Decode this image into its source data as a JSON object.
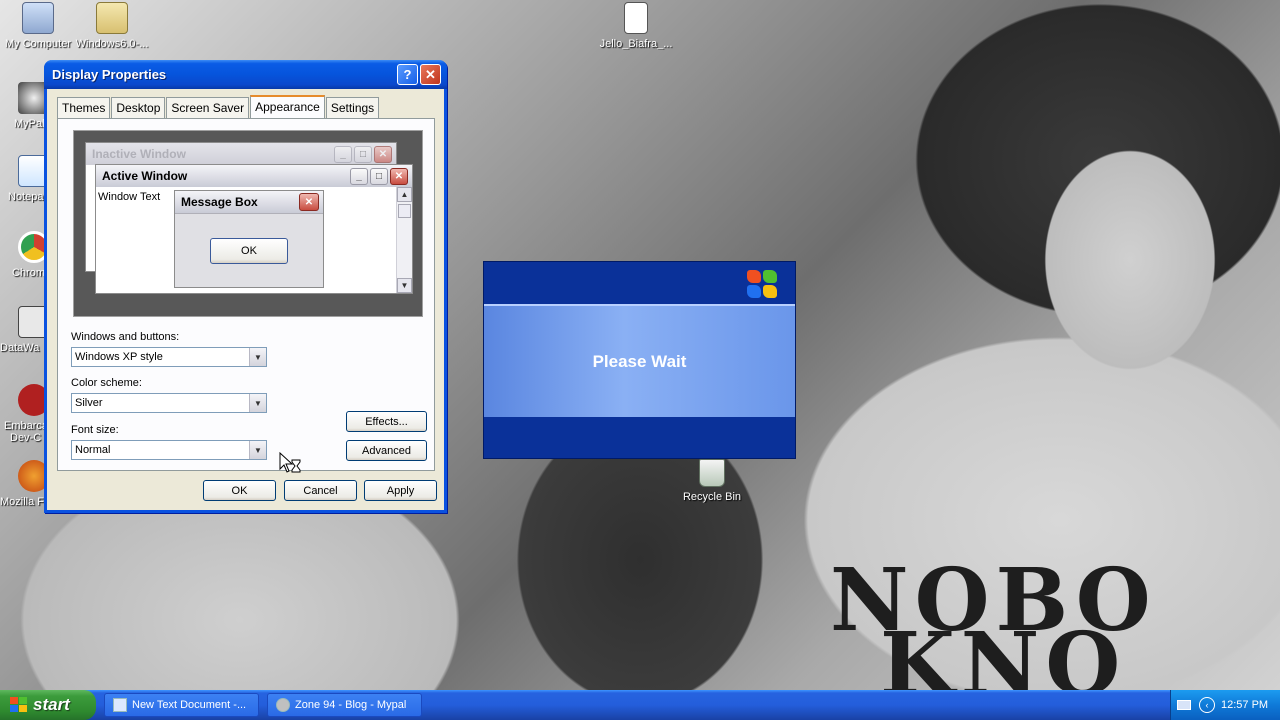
{
  "desktop": {
    "icons_top": [
      {
        "label": "My Computer"
      },
      {
        "label": "Windows6.0-..."
      },
      {
        "label": "Jello_Biafra_..."
      }
    ],
    "icons_left": [
      {
        "label": "MyPal"
      },
      {
        "label": "Notepad"
      },
      {
        "label": "Chrome"
      },
      {
        "label": "DataWa"
      },
      {
        "label": "Embarca"
      },
      {
        "label": "Dev-C"
      },
      {
        "label": "Mozilla F"
      }
    ],
    "recycle_bin": {
      "label": "Recycle Bin"
    },
    "wallpaper_text": {
      "line1": "NOBO",
      "line2": "KNO"
    }
  },
  "dialog": {
    "title": "Display Properties",
    "help_icon_glyph": "?",
    "close_icon_glyph": "✕",
    "tabs": [
      "Themes",
      "Desktop",
      "Screen Saver",
      "Appearance",
      "Settings"
    ],
    "active_tab": "Appearance",
    "preview": {
      "inactive_title": "Inactive Window",
      "active_title": "Active Window",
      "window_text": "Window Text",
      "message_box_title": "Message Box",
      "message_box_ok": "OK"
    },
    "windows_buttons_label": "Windows and buttons:",
    "windows_buttons_value": "Windows XP style",
    "color_scheme_label": "Color scheme:",
    "color_scheme_value": "Silver",
    "font_size_label": "Font size:",
    "font_size_value": "Normal",
    "effects_button": "Effects...",
    "advanced_button": "Advanced",
    "ok_button": "OK",
    "cancel_button": "Cancel",
    "apply_button": "Apply"
  },
  "wait_dialog": {
    "message": "Please Wait"
  },
  "taskbar": {
    "start_label": "start",
    "items": [
      {
        "label": "New Text Document -..."
      },
      {
        "label": "Zone 94 - Blog - Mypal"
      }
    ],
    "clock": "12:57 PM"
  },
  "colors": {
    "xp_blue": "#0a52e0",
    "dialog_face": "#ece9d8",
    "taskbar_blue": "#245edb",
    "start_green": "#3c9c3c",
    "tray_blue": "#0f7ad8"
  }
}
